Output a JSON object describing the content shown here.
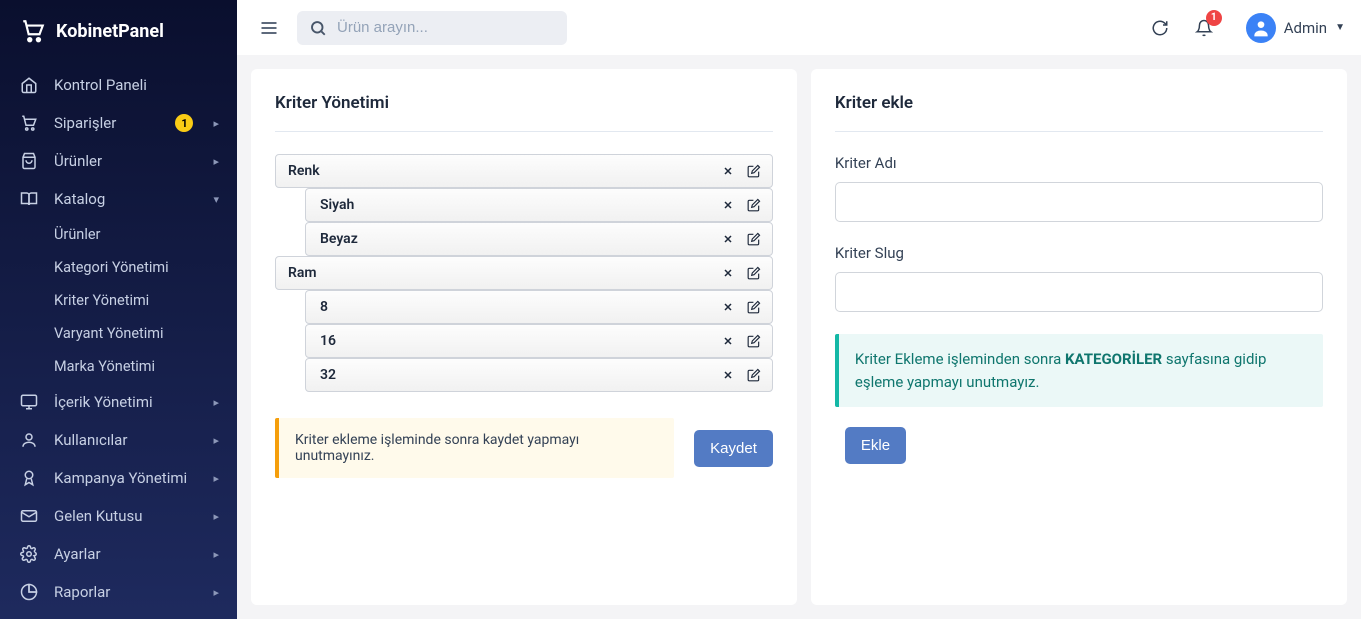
{
  "brand": "KobinetPanel",
  "search": {
    "placeholder": "Ürün arayın..."
  },
  "topbar": {
    "notification_count": "1",
    "user_name": "Admin"
  },
  "sidebar": {
    "items": [
      {
        "label": "Kontrol Paneli"
      },
      {
        "label": "Siparişler",
        "badge": "1"
      },
      {
        "label": "Ürünler"
      },
      {
        "label": "Katalog"
      },
      {
        "label": "İçerik Yönetimi"
      },
      {
        "label": "Kullanıcılar"
      },
      {
        "label": "Kampanya Yönetimi"
      },
      {
        "label": "Gelen Kutusu"
      },
      {
        "label": "Ayarlar"
      },
      {
        "label": "Raporlar"
      }
    ],
    "katalog_sub": [
      {
        "label": "Ürünler"
      },
      {
        "label": "Kategori Yönetimi"
      },
      {
        "label": "Kriter Yönetimi"
      },
      {
        "label": "Varyant Yönetimi"
      },
      {
        "label": "Marka Yönetimi"
      }
    ]
  },
  "left": {
    "title": "Kriter Yönetimi",
    "groups": [
      {
        "name": "Renk",
        "children": [
          "Siyah",
          "Beyaz"
        ]
      },
      {
        "name": "Ram",
        "children": [
          "8",
          "16",
          "32"
        ]
      }
    ],
    "warning": "Kriter ekleme işleminde sonra kaydet yapmayı unutmayınız.",
    "save_btn": "Kaydet"
  },
  "right": {
    "title": "Kriter ekle",
    "field1_label": "Kriter Adı",
    "field2_label": "Kriter Slug",
    "info_pre": "Kriter Ekleme işleminden sonra ",
    "info_strong": "KATEGORİLER",
    "info_post": " sayfasına gidip eşleme yapmayı unutmayız.",
    "add_btn": "Ekle"
  }
}
